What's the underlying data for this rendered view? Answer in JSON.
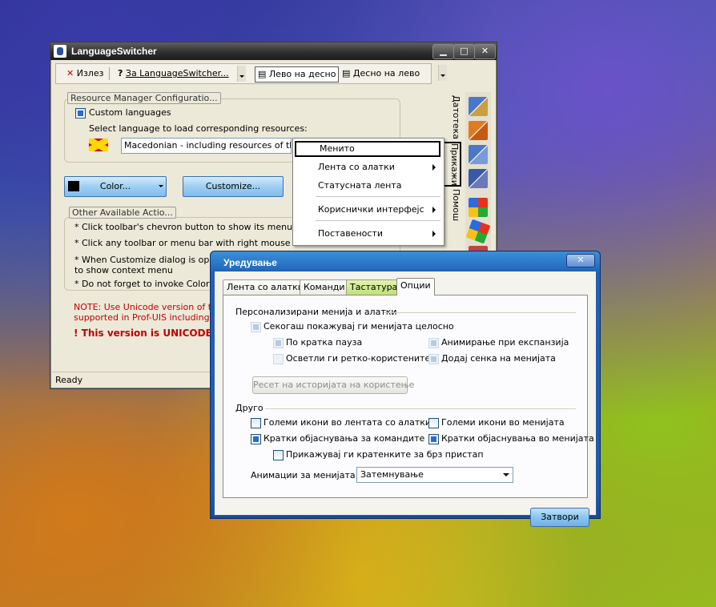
{
  "main_window": {
    "title": "LanguageSwitcher",
    "caption_buttons": {
      "minimize": "▁",
      "maximize": "□",
      "close": "✕"
    },
    "toolbar": {
      "exit_label": "Излез",
      "about_label": "За LanguageSwitcher...",
      "ltr_label": "Лево на десно",
      "rtl_label": "Десно на лево"
    },
    "resource_group": {
      "title": "Resource Manager Configuratio...",
      "custom_languages_label": "Custom languages",
      "custom_languages_checked": true,
      "select_prompt": "Select language to load corresponding resources:",
      "language_value": "Macedonian - including resources of this sam"
    },
    "buttons": {
      "color_label": "Color...",
      "customize_label": "Customize..."
    },
    "actions_group": {
      "title": "Other Available Actio...",
      "lines": [
        "* Click toolbar's chevron button to show its menu",
        "* Click any toolbar or menu bar with right mouse button to show context menu",
        "* When Customize dialog is open, cl",
        "to show context menu",
        "* Do not forget to invoke Color Selec"
      ]
    },
    "note_lines": [
      "NOTE: Use Unicode version of this",
      "supported in Prof-UIS including Chin"
    ],
    "unicode_warning": "! This version is UNICODE",
    "status": "Ready",
    "vertical_tabs": [
      "Датотека",
      "Прикажи",
      "Помош"
    ],
    "sidebar_icons": [
      "grid-icon",
      "grid-icon",
      "grid-icon",
      "grid-icon",
      "windows-flag-icon",
      "windows-flag-icon",
      "tool-icon"
    ]
  },
  "context_menu": {
    "items": [
      {
        "label": "Менито",
        "submenu": false,
        "highlighted": true
      },
      {
        "label": "Лента со алатки",
        "submenu": true
      },
      {
        "label": "Статусната лента",
        "submenu": false
      },
      {
        "label": "Кориснички интерфејс",
        "submenu": true
      },
      {
        "label": "Поставености",
        "submenu": true
      }
    ]
  },
  "dialog": {
    "title": "Уредување",
    "close_glyph": "✕",
    "tabs": [
      "Лента со алатки",
      "Команди",
      "Тастатура",
      "Опции"
    ],
    "active_tab": "Опции",
    "personalized": {
      "heading": "Персонализирани менија и алатки",
      "always_show_full": "Секогаш покажувај ги менијата целосно",
      "after_pause": "По кратка пауза",
      "highlight_rare": "Осветли ги ретко-користените",
      "animate_expand": "Анимирање при експанзија",
      "add_shadow": "Додај сенка на менијата",
      "reset_button": "Ресет на историјата на користење"
    },
    "other": {
      "heading": "Друго",
      "large_toolbar_icons": "Големи икони во лентата со алатки",
      "large_menu_icons": "Големи икони во менијата",
      "command_tips": "Кратки објаснувања за командите",
      "menu_tips": "Кратки објаснувања во менијата",
      "show_shortcuts": "Прикажувај ги кратенките за брз пристап",
      "menu_animation_label": "Анимации за менијата:",
      "menu_animation_value": "Затемнување"
    },
    "close_button": "Затвори"
  }
}
